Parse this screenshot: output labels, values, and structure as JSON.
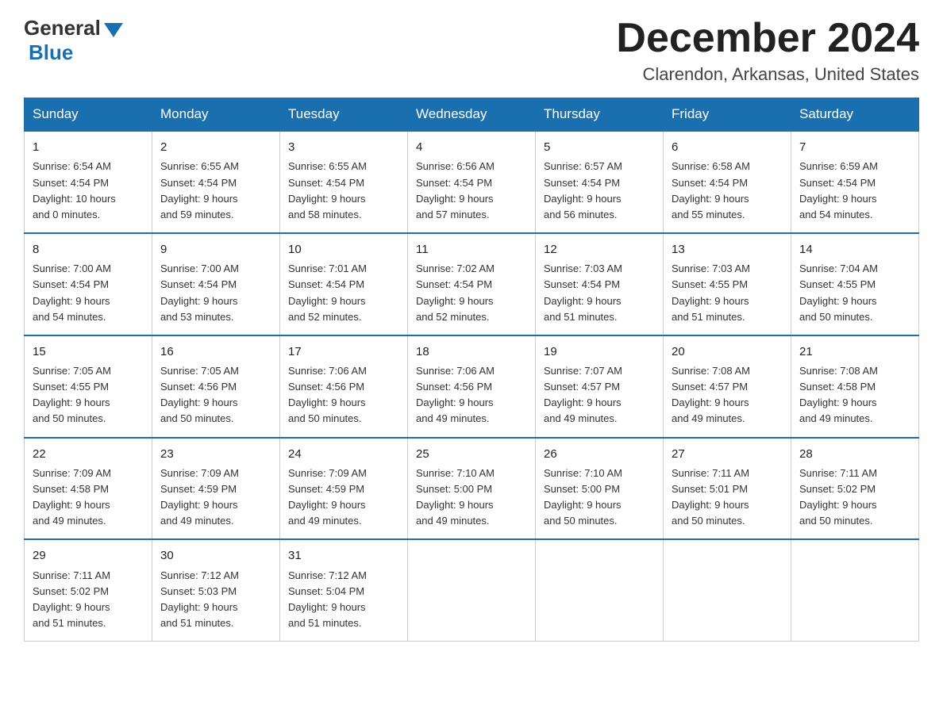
{
  "logo": {
    "general": "General",
    "arrow": "▶",
    "blue": "Blue"
  },
  "header": {
    "month": "December 2024",
    "location": "Clarendon, Arkansas, United States"
  },
  "days_of_week": [
    "Sunday",
    "Monday",
    "Tuesday",
    "Wednesday",
    "Thursday",
    "Friday",
    "Saturday"
  ],
  "weeks": [
    [
      {
        "num": "1",
        "info": "Sunrise: 6:54 AM\nSunset: 4:54 PM\nDaylight: 10 hours\nand 0 minutes."
      },
      {
        "num": "2",
        "info": "Sunrise: 6:55 AM\nSunset: 4:54 PM\nDaylight: 9 hours\nand 59 minutes."
      },
      {
        "num": "3",
        "info": "Sunrise: 6:55 AM\nSunset: 4:54 PM\nDaylight: 9 hours\nand 58 minutes."
      },
      {
        "num": "4",
        "info": "Sunrise: 6:56 AM\nSunset: 4:54 PM\nDaylight: 9 hours\nand 57 minutes."
      },
      {
        "num": "5",
        "info": "Sunrise: 6:57 AM\nSunset: 4:54 PM\nDaylight: 9 hours\nand 56 minutes."
      },
      {
        "num": "6",
        "info": "Sunrise: 6:58 AM\nSunset: 4:54 PM\nDaylight: 9 hours\nand 55 minutes."
      },
      {
        "num": "7",
        "info": "Sunrise: 6:59 AM\nSunset: 4:54 PM\nDaylight: 9 hours\nand 54 minutes."
      }
    ],
    [
      {
        "num": "8",
        "info": "Sunrise: 7:00 AM\nSunset: 4:54 PM\nDaylight: 9 hours\nand 54 minutes."
      },
      {
        "num": "9",
        "info": "Sunrise: 7:00 AM\nSunset: 4:54 PM\nDaylight: 9 hours\nand 53 minutes."
      },
      {
        "num": "10",
        "info": "Sunrise: 7:01 AM\nSunset: 4:54 PM\nDaylight: 9 hours\nand 52 minutes."
      },
      {
        "num": "11",
        "info": "Sunrise: 7:02 AM\nSunset: 4:54 PM\nDaylight: 9 hours\nand 52 minutes."
      },
      {
        "num": "12",
        "info": "Sunrise: 7:03 AM\nSunset: 4:54 PM\nDaylight: 9 hours\nand 51 minutes."
      },
      {
        "num": "13",
        "info": "Sunrise: 7:03 AM\nSunset: 4:55 PM\nDaylight: 9 hours\nand 51 minutes."
      },
      {
        "num": "14",
        "info": "Sunrise: 7:04 AM\nSunset: 4:55 PM\nDaylight: 9 hours\nand 50 minutes."
      }
    ],
    [
      {
        "num": "15",
        "info": "Sunrise: 7:05 AM\nSunset: 4:55 PM\nDaylight: 9 hours\nand 50 minutes."
      },
      {
        "num": "16",
        "info": "Sunrise: 7:05 AM\nSunset: 4:56 PM\nDaylight: 9 hours\nand 50 minutes."
      },
      {
        "num": "17",
        "info": "Sunrise: 7:06 AM\nSunset: 4:56 PM\nDaylight: 9 hours\nand 50 minutes."
      },
      {
        "num": "18",
        "info": "Sunrise: 7:06 AM\nSunset: 4:56 PM\nDaylight: 9 hours\nand 49 minutes."
      },
      {
        "num": "19",
        "info": "Sunrise: 7:07 AM\nSunset: 4:57 PM\nDaylight: 9 hours\nand 49 minutes."
      },
      {
        "num": "20",
        "info": "Sunrise: 7:08 AM\nSunset: 4:57 PM\nDaylight: 9 hours\nand 49 minutes."
      },
      {
        "num": "21",
        "info": "Sunrise: 7:08 AM\nSunset: 4:58 PM\nDaylight: 9 hours\nand 49 minutes."
      }
    ],
    [
      {
        "num": "22",
        "info": "Sunrise: 7:09 AM\nSunset: 4:58 PM\nDaylight: 9 hours\nand 49 minutes."
      },
      {
        "num": "23",
        "info": "Sunrise: 7:09 AM\nSunset: 4:59 PM\nDaylight: 9 hours\nand 49 minutes."
      },
      {
        "num": "24",
        "info": "Sunrise: 7:09 AM\nSunset: 4:59 PM\nDaylight: 9 hours\nand 49 minutes."
      },
      {
        "num": "25",
        "info": "Sunrise: 7:10 AM\nSunset: 5:00 PM\nDaylight: 9 hours\nand 49 minutes."
      },
      {
        "num": "26",
        "info": "Sunrise: 7:10 AM\nSunset: 5:00 PM\nDaylight: 9 hours\nand 50 minutes."
      },
      {
        "num": "27",
        "info": "Sunrise: 7:11 AM\nSunset: 5:01 PM\nDaylight: 9 hours\nand 50 minutes."
      },
      {
        "num": "28",
        "info": "Sunrise: 7:11 AM\nSunset: 5:02 PM\nDaylight: 9 hours\nand 50 minutes."
      }
    ],
    [
      {
        "num": "29",
        "info": "Sunrise: 7:11 AM\nSunset: 5:02 PM\nDaylight: 9 hours\nand 51 minutes."
      },
      {
        "num": "30",
        "info": "Sunrise: 7:12 AM\nSunset: 5:03 PM\nDaylight: 9 hours\nand 51 minutes."
      },
      {
        "num": "31",
        "info": "Sunrise: 7:12 AM\nSunset: 5:04 PM\nDaylight: 9 hours\nand 51 minutes."
      },
      {
        "num": "",
        "info": ""
      },
      {
        "num": "",
        "info": ""
      },
      {
        "num": "",
        "info": ""
      },
      {
        "num": "",
        "info": ""
      }
    ]
  ]
}
